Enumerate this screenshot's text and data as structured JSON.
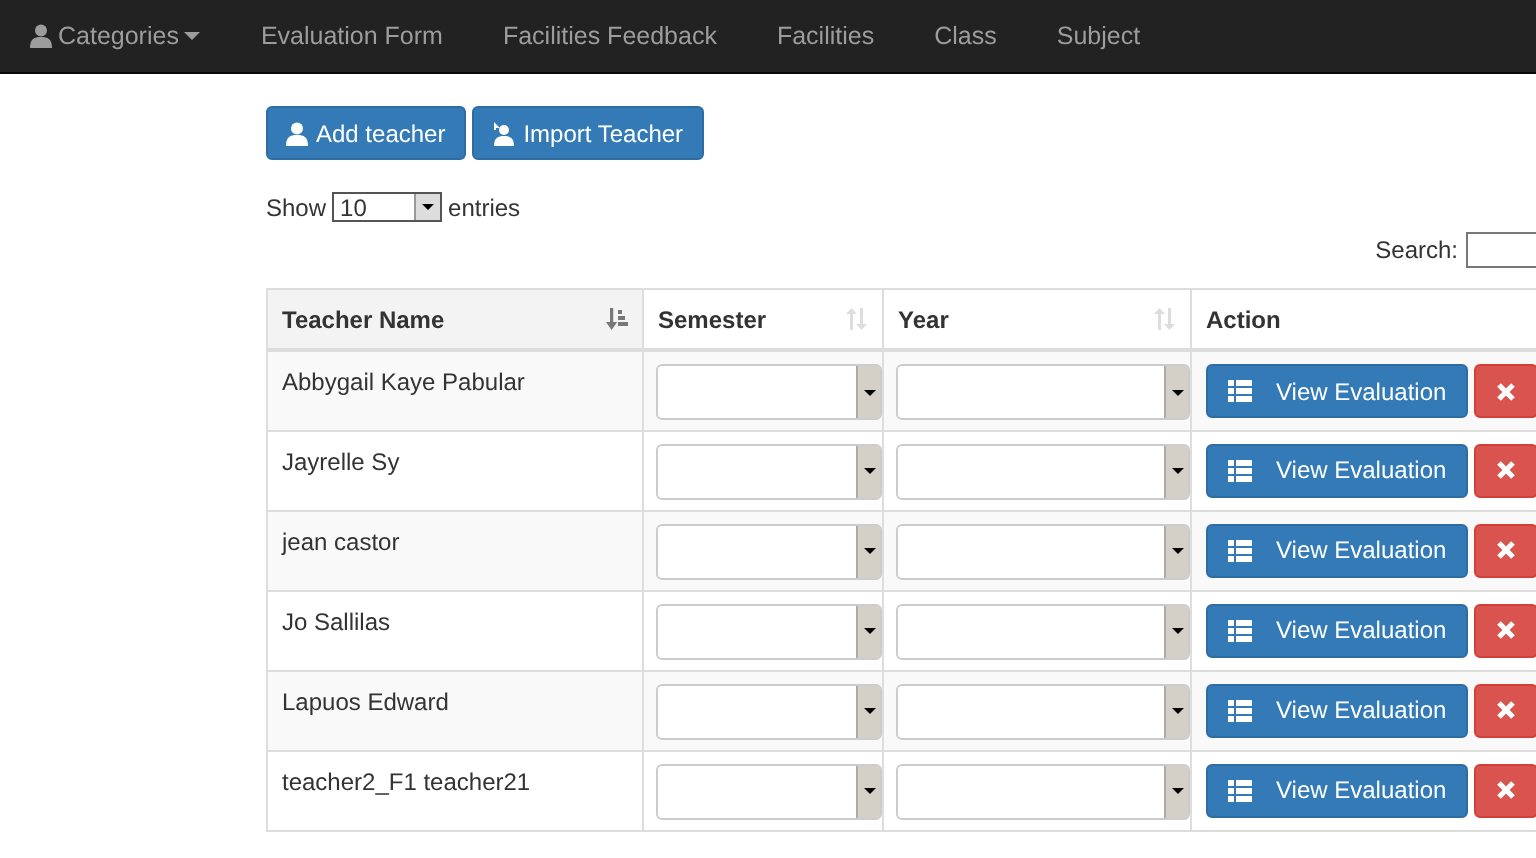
{
  "navbar": {
    "items": [
      {
        "label": "Categories",
        "kind": "dropdown"
      },
      {
        "label": "Evaluation Form",
        "kind": "link"
      },
      {
        "label": "Facilities Feedback",
        "kind": "link"
      },
      {
        "label": "Facilities",
        "kind": "link"
      },
      {
        "label": "Class",
        "kind": "link"
      },
      {
        "label": "Subject",
        "kind": "link"
      }
    ]
  },
  "toolbar": {
    "buttons": [
      {
        "label": "Add teacher",
        "kind": "add"
      },
      {
        "label": "Import Teacher",
        "kind": "import"
      }
    ]
  },
  "length_menu": {
    "prefix": "Show",
    "value": "10",
    "suffix": "entries"
  },
  "search": {
    "label": "Search:"
  },
  "table": {
    "columns": [
      {
        "label": "Teacher Name",
        "kind": "sortable",
        "sorted": true
      },
      {
        "label": "Semester",
        "kind": "sortable",
        "sorted": false
      },
      {
        "label": "Year",
        "kind": "sortable",
        "sorted": false
      },
      {
        "label": "Action",
        "kind": "plain",
        "sorted": false
      }
    ],
    "rows": [
      {
        "name": "Abbygail Kaye Pabular",
        "action": "View Evaluation"
      },
      {
        "name": "Jayrelle Sy",
        "action": "View Evaluation"
      },
      {
        "name": "jean castor",
        "action": "View Evaluation"
      },
      {
        "name": "Jo Sallilas",
        "action": "View Evaluation"
      },
      {
        "name": "Lapuos Edward",
        "action": "View Evaluation"
      },
      {
        "name": "teacher2_F1 teacher21",
        "action": "View Evaluation"
      }
    ]
  }
}
